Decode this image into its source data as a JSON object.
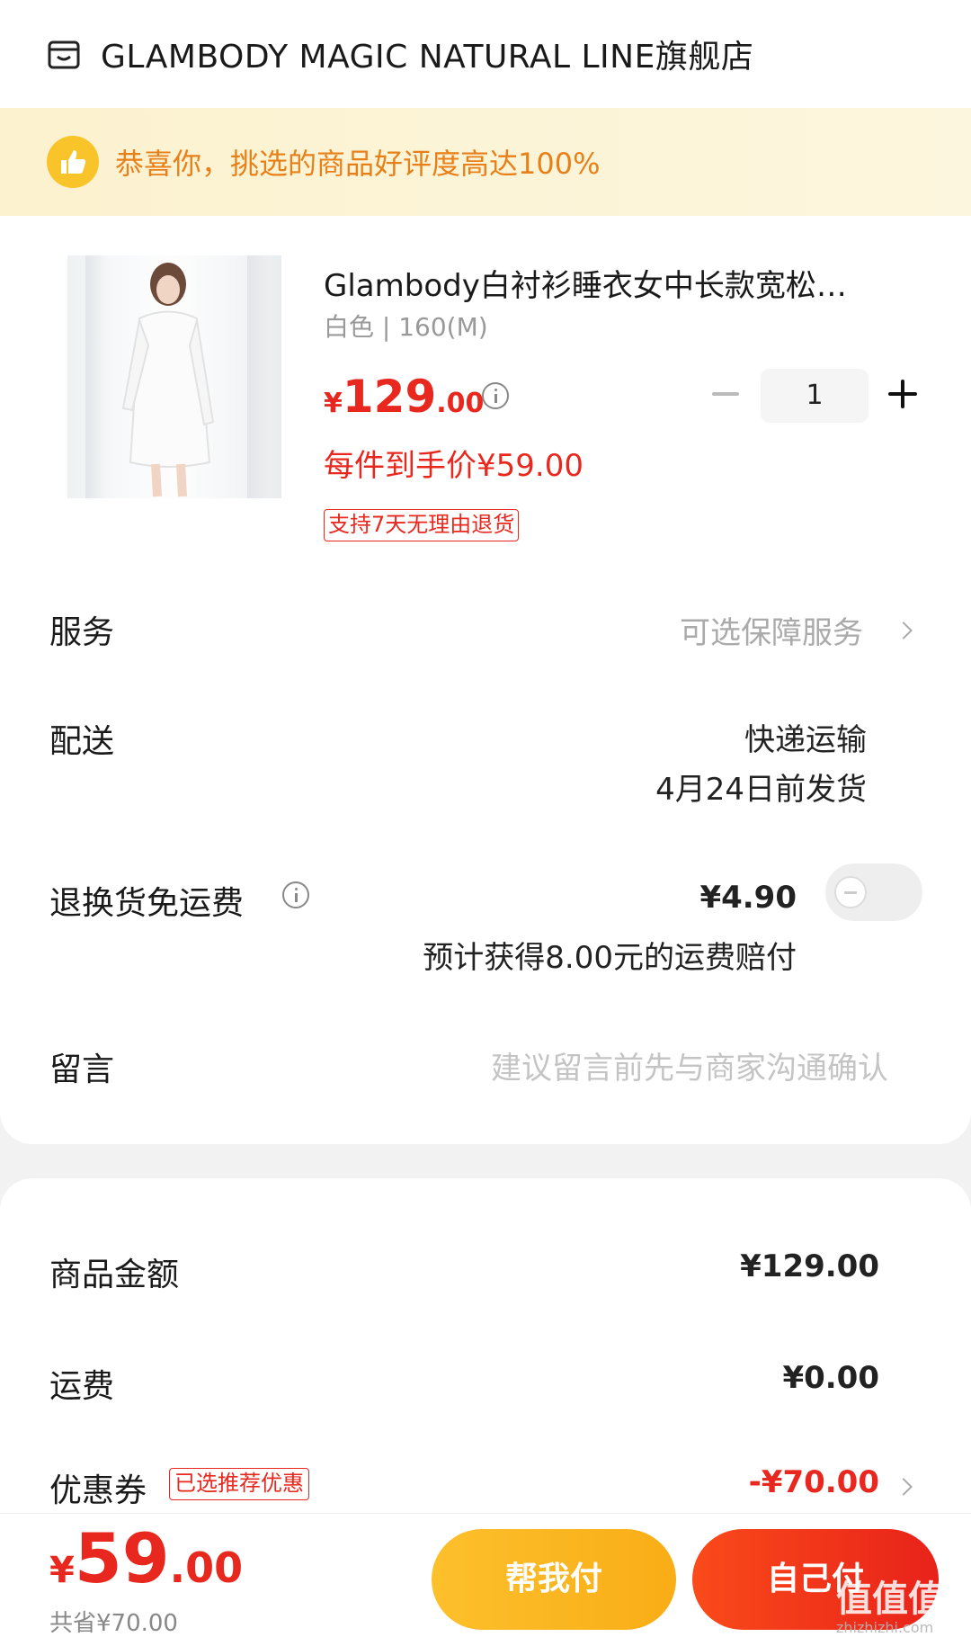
{
  "shop": {
    "name": "GLAMBODY MAGIC NATURAL LINE旗舰店",
    "icon": "shop-icon"
  },
  "praise": {
    "text": "恭喜你，挑选的商品好评度高达100%",
    "icon": "thumbs-up-icon"
  },
  "product": {
    "title": "Glambody白衬衫睡衣女中长款宽松…",
    "spec": "白色 | 160(M)",
    "price_symbol": "¥",
    "price_int": "129",
    "price_dec": ".00",
    "final_price": "每件到手价¥59.00",
    "return_tag": "支持7天无理由退货",
    "quantity": "1"
  },
  "service": {
    "label": "服务",
    "value": "可选保障服务"
  },
  "delivery": {
    "label": "配送",
    "method": "快递运输",
    "ship_date": "4月24日前发货"
  },
  "return_shipping": {
    "label": "退换货免运费",
    "price": "¥4.90",
    "note": "预计获得8.00元的运费赔付",
    "toggle_on": false
  },
  "message": {
    "label": "留言",
    "placeholder": "建议留言前先与商家沟通确认"
  },
  "summary": {
    "goods_label": "商品金额",
    "goods_value": "¥129.00",
    "shipping_label": "运费",
    "shipping_value": "¥0.00",
    "coupon_label": "优惠券",
    "coupon_tag": "已选推荐优惠",
    "coupon_value": "-¥70.00"
  },
  "bottom": {
    "total_symbol": "¥",
    "total_int": "59",
    "total_dec": ".00",
    "saved": "共省¥70.00",
    "help_pay": "帮我付",
    "self_pay": "自己付"
  },
  "watermark": {
    "text": "值值值",
    "sub": "zhizhizhi.com"
  },
  "colors": {
    "accent_red": "#e8281e",
    "accent_orange": "#e8801a",
    "help_btn": "#fcc02c",
    "self_btn": "#fa4a1a"
  }
}
